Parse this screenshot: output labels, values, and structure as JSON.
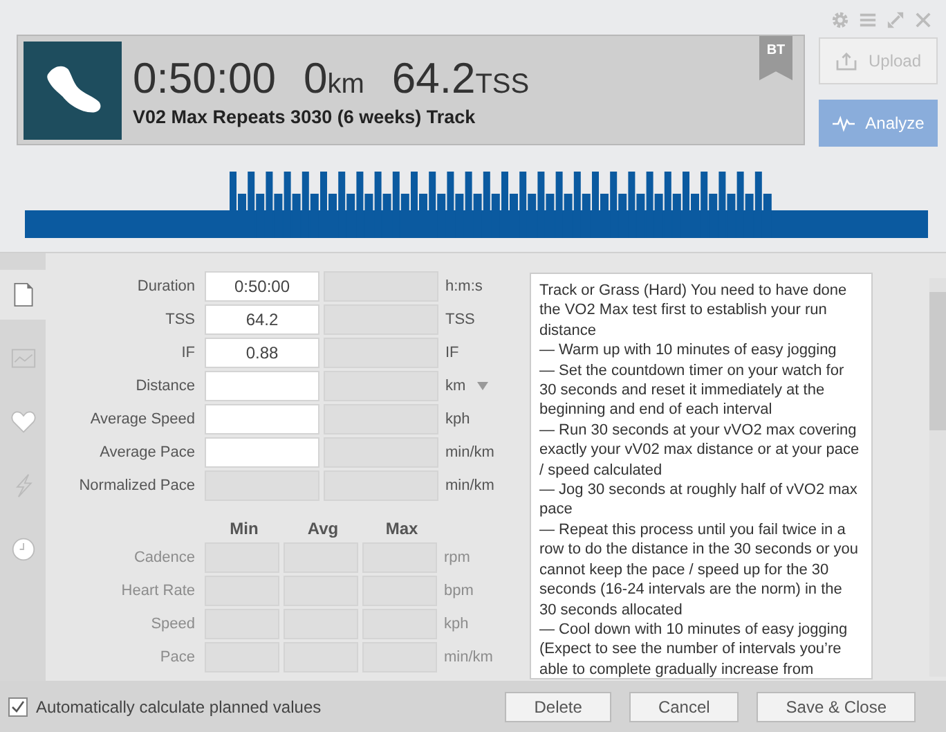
{
  "summary": {
    "duration": "0:50:00",
    "distance": "0",
    "distance_unit": "km",
    "tss": "64.2",
    "tss_unit": "TSS",
    "title": "V02 Max Repeats 3030 (6 weeks) Track",
    "badge": "BT"
  },
  "actions": [
    {
      "label": "Upload",
      "disabled": true,
      "kind": "upload"
    },
    {
      "label": "Analyze",
      "disabled": false,
      "kind": "analyze"
    }
  ],
  "sidebar": {
    "items": [
      {
        "kind": "document",
        "selected": true
      },
      {
        "kind": "chart",
        "selected": false
      },
      {
        "kind": "heart",
        "selected": false
      },
      {
        "kind": "bolt",
        "selected": false
      },
      {
        "kind": "clock",
        "selected": false
      }
    ]
  },
  "metrics": [
    {
      "label": "Duration",
      "planned": "0:50:00",
      "planned_disabled": false,
      "unit": "h:m:s",
      "has_dropdown": false
    },
    {
      "label": "TSS",
      "planned": "64.2",
      "planned_disabled": false,
      "unit": "TSS",
      "has_dropdown": false
    },
    {
      "label": "IF",
      "planned": "0.88",
      "planned_disabled": false,
      "unit": "IF",
      "has_dropdown": false
    },
    {
      "label": "Distance",
      "planned_disabled": false,
      "unit": "km",
      "has_dropdown": true
    },
    {
      "label": "Average Speed",
      "planned_disabled": false,
      "unit": "kph",
      "has_dropdown": false
    },
    {
      "label": "Average Pace",
      "planned_disabled": false,
      "unit": "min/km",
      "has_dropdown": false
    },
    {
      "label": "Normalized Pace",
      "planned_disabled": true,
      "unit": "min/km",
      "has_dropdown": false
    }
  ],
  "range_columns": [
    "Min",
    "Avg",
    "Max"
  ],
  "ranges": [
    {
      "label": "Cadence",
      "unit": "rpm",
      "disabled": true
    },
    {
      "label": "Heart Rate",
      "unit": "bpm",
      "disabled": true
    },
    {
      "label": "Speed",
      "unit": "kph",
      "disabled": true
    },
    {
      "label": "Pace",
      "unit": "min/km",
      "disabled": true
    }
  ],
  "description": "Track or Grass (Hard) You need to have done the VO2 Max test first to establish your run distance\n— Warm up with 10 minutes of easy jogging\n— Set the countdown timer on your watch for 30 seconds and reset it immediately at the beginning and end of each interval\n— Run 30 seconds at your vVO2 max covering exactly your vV02 max distance or at your pace / speed calculated\n— Jog 30 seconds at roughly half of vVO2 max pace\n— Repeat this process until you fail twice in a row to do the distance in the 30 seconds or you cannot keep the pace / speed up for the 30 seconds (16-24 intervals are the norm) in the 30 seconds allocated\n— Cool down with 10 minutes of easy jogging\n(Expect to see the number of intervals you’re able to complete gradually increase from",
  "auto_calculate": {
    "label": "Automatically calculate planned values",
    "checked": true
  },
  "buttons": [
    "Delete",
    "Cancel",
    "Save & Close"
  ]
}
